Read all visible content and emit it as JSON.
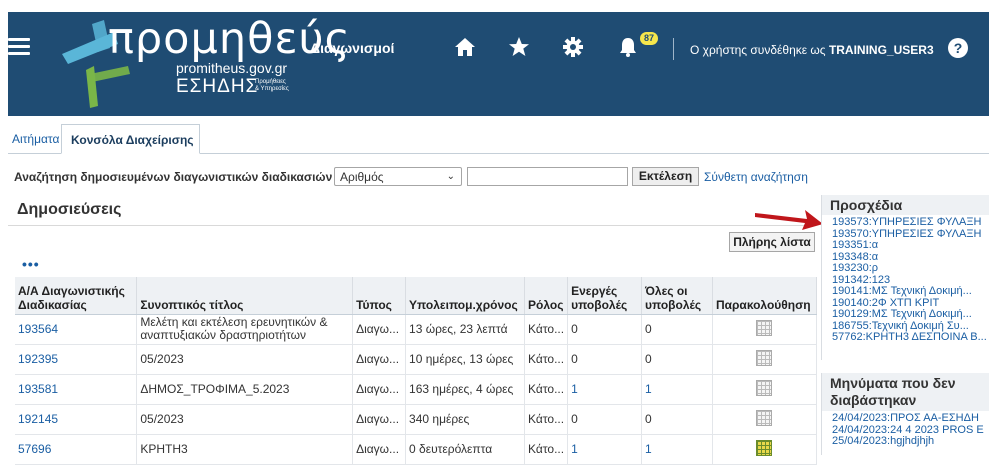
{
  "header": {
    "logo_word": "προμηθεύς",
    "logo_url": "promitheus.gov.gr",
    "logo_org": "ΕΣΗΔΗΣ",
    "logo_org_sub1": "Προμήθειες",
    "logo_org_sub2": "& Υπηρεσίες",
    "app_name": "Διαγωνισμοί",
    "notification_count": "87",
    "user_prefix": "Ο χρήστης συνδέθηκε ως",
    "username": "TRAINING_USER3",
    "help_label": "?",
    "icons": [
      "menu-icon",
      "home-icon",
      "star-icon",
      "gear-icon",
      "bell-icon",
      "help-icon"
    ]
  },
  "tabs": [
    {
      "label": "Αιτήματα",
      "active": false
    },
    {
      "label": "Κονσόλα Διαχείρισης",
      "active": true
    }
  ],
  "search": {
    "label": "Αναζήτηση δημοσιευμένων διαγωνιστικών διαδικασιών",
    "select_value": "Αριθμός",
    "input_value": "",
    "go_label": "Εκτέλεση",
    "advanced_label": "Σύνθετη αναζήτηση"
  },
  "publications": {
    "title": "Δημοσιεύσεις",
    "full_list_label": "Πλήρης λίστα",
    "more_label": "•••",
    "columns": [
      "Α/Α Διαγωνιστικής Διαδικασίας",
      "Συνοπτικός τίτλος",
      "Τύπος",
      "Υπολειπομ.χρόνος",
      "Ρόλος",
      "Ενεργές υποβολές",
      "Όλες οι υποβολές",
      "Παρακολούθηση"
    ],
    "rows": [
      {
        "id": "193564",
        "title": "Μελέτη και εκτέλεση ερευνητικών & αναπτυξιακών δραστηριοτήτων",
        "type": "Διαγω...",
        "remaining": "13 ώρες, 23 λεπτά",
        "role": "Κάτο...",
        "active": "0",
        "all": "0",
        "monitor": "off"
      },
      {
        "id": "192395",
        "title": "05/2023",
        "type": "Διαγω...",
        "remaining": "10 ημέρες, 13 ώρες",
        "role": "Κάτο...",
        "active": "0",
        "all": "0",
        "monitor": "off"
      },
      {
        "id": "193581",
        "title": "ΔΗΜΟΣ_ΤΡΟΦΙΜΑ_5.2023",
        "type": "Διαγω...",
        "remaining": "163 ημέρες, 4 ώρες",
        "role": "Κάτο...",
        "active": "1",
        "all": "1",
        "monitor": "off"
      },
      {
        "id": "192145",
        "title": "05/2023",
        "type": "Διαγω...",
        "remaining": "340 ημέρες",
        "role": "Κάτο...",
        "active": "0",
        "all": "0",
        "monitor": "off"
      },
      {
        "id": "57696",
        "title": "ΚΡΗΤΗ3",
        "type": "Διαγω...",
        "remaining": "0 δευτερόλεπτα",
        "role": "Κάτο...",
        "active": "1",
        "all": "1",
        "monitor": "on"
      }
    ]
  },
  "drafts": {
    "title": "Προσχέδια",
    "items": [
      "193573:ΥΠΗΡΕΣΙΕΣ ΦΥΛΑΞΗ",
      "193570:ΥΠΗΡΕΣΙΕΣ ΦΥΛΑΞΗ",
      "193351:α",
      "193348:α",
      "193230:ρ",
      "191342:123",
      "190141:ΜΣ Τεχνική Δοκιμή...",
      "190140:2Φ ΧΤΠ ΚΡΙΤ",
      "190129:ΜΣ Τεχνική Δοκιμή...",
      "186755:Τεχνική Δοκιμή Συ...",
      "57762:ΚΡΗΤΗ3 ΔΕΣΠΟΙΝΑ Β..."
    ]
  },
  "unread": {
    "title_line1": "Μηνύματα που δεν",
    "title_line2": "διαβάστηκαν",
    "items": [
      "24/04/2023:ΠΡΟΣ ΑΑ-ΕΣΗΔΗ",
      "24/04/2023:24 4 2023 PROS E",
      "25/04/2023:hgjhdjhjh"
    ]
  },
  "colors": {
    "header_bg": "#1f4c73",
    "link": "#1a5ea3",
    "arrow": "#c0161b",
    "badge": "#f5e64c"
  }
}
